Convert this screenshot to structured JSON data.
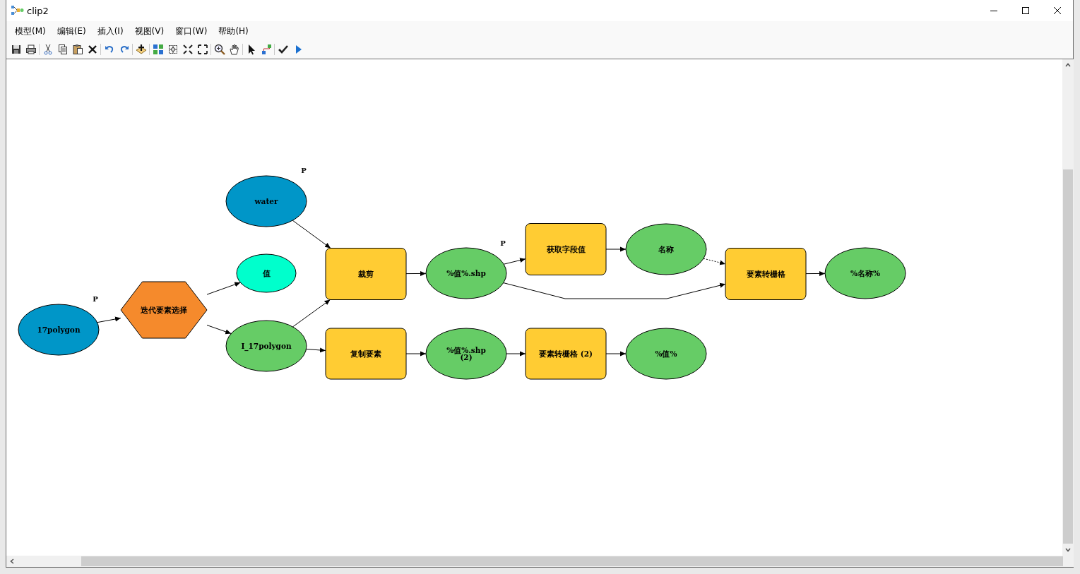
{
  "window": {
    "title": "clip2"
  },
  "menu": [
    "模型(M)",
    "编辑(E)",
    "插入(I)",
    "视图(V)",
    "窗口(W)",
    "帮助(H)"
  ],
  "nodes": [
    {
      "kind": "input",
      "label": "17polygon",
      "parameter_mark": "P",
      "connections": [
        {
          "kind": "flow"
        }
      ]
    },
    {
      "kind": "iterator",
      "label": "迭代要素选择",
      "connections": [
        {
          "kind": "flow"
        },
        {
          "kind": "flow"
        }
      ]
    },
    {
      "kind": "input",
      "label": "water",
      "parameter_mark": "P",
      "connections": [
        {
          "kind": "flow"
        }
      ]
    },
    {
      "kind": "value",
      "label": "值"
    },
    {
      "kind": "output",
      "label": "I_17polygon",
      "connections": [
        {
          "kind": "flow"
        },
        {
          "kind": "flow"
        }
      ]
    },
    {
      "kind": "tool",
      "label": "裁剪",
      "connections": [
        {
          "kind": "flow"
        }
      ]
    },
    {
      "kind": "output",
      "label": "%值%.shp",
      "parameter_mark": "P",
      "connections": [
        {
          "kind": "flow"
        },
        {
          "kind": "flow"
        }
      ]
    },
    {
      "kind": "tool",
      "label": "获取字段值",
      "connections": [
        {
          "kind": "flow"
        }
      ]
    },
    {
      "kind": "output",
      "label": "名称",
      "connections": [
        {
          "kind": "precondition"
        }
      ]
    },
    {
      "kind": "tool",
      "label": "要素转栅格",
      "connections": [
        {
          "kind": "flow"
        }
      ]
    },
    {
      "kind": "output",
      "label": "%名称%"
    },
    {
      "kind": "tool",
      "label": "复制要素",
      "connections": [
        {
          "kind": "flow"
        }
      ]
    },
    {
      "kind": "output",
      "label": "%值%.shp\n(2)",
      "connections": [
        {
          "kind": "flow"
        }
      ]
    },
    {
      "kind": "tool",
      "label": "要素转栅格 (2)",
      "connections": [
        {
          "kind": "flow"
        }
      ]
    },
    {
      "kind": "output",
      "label": "%值%"
    }
  ]
}
